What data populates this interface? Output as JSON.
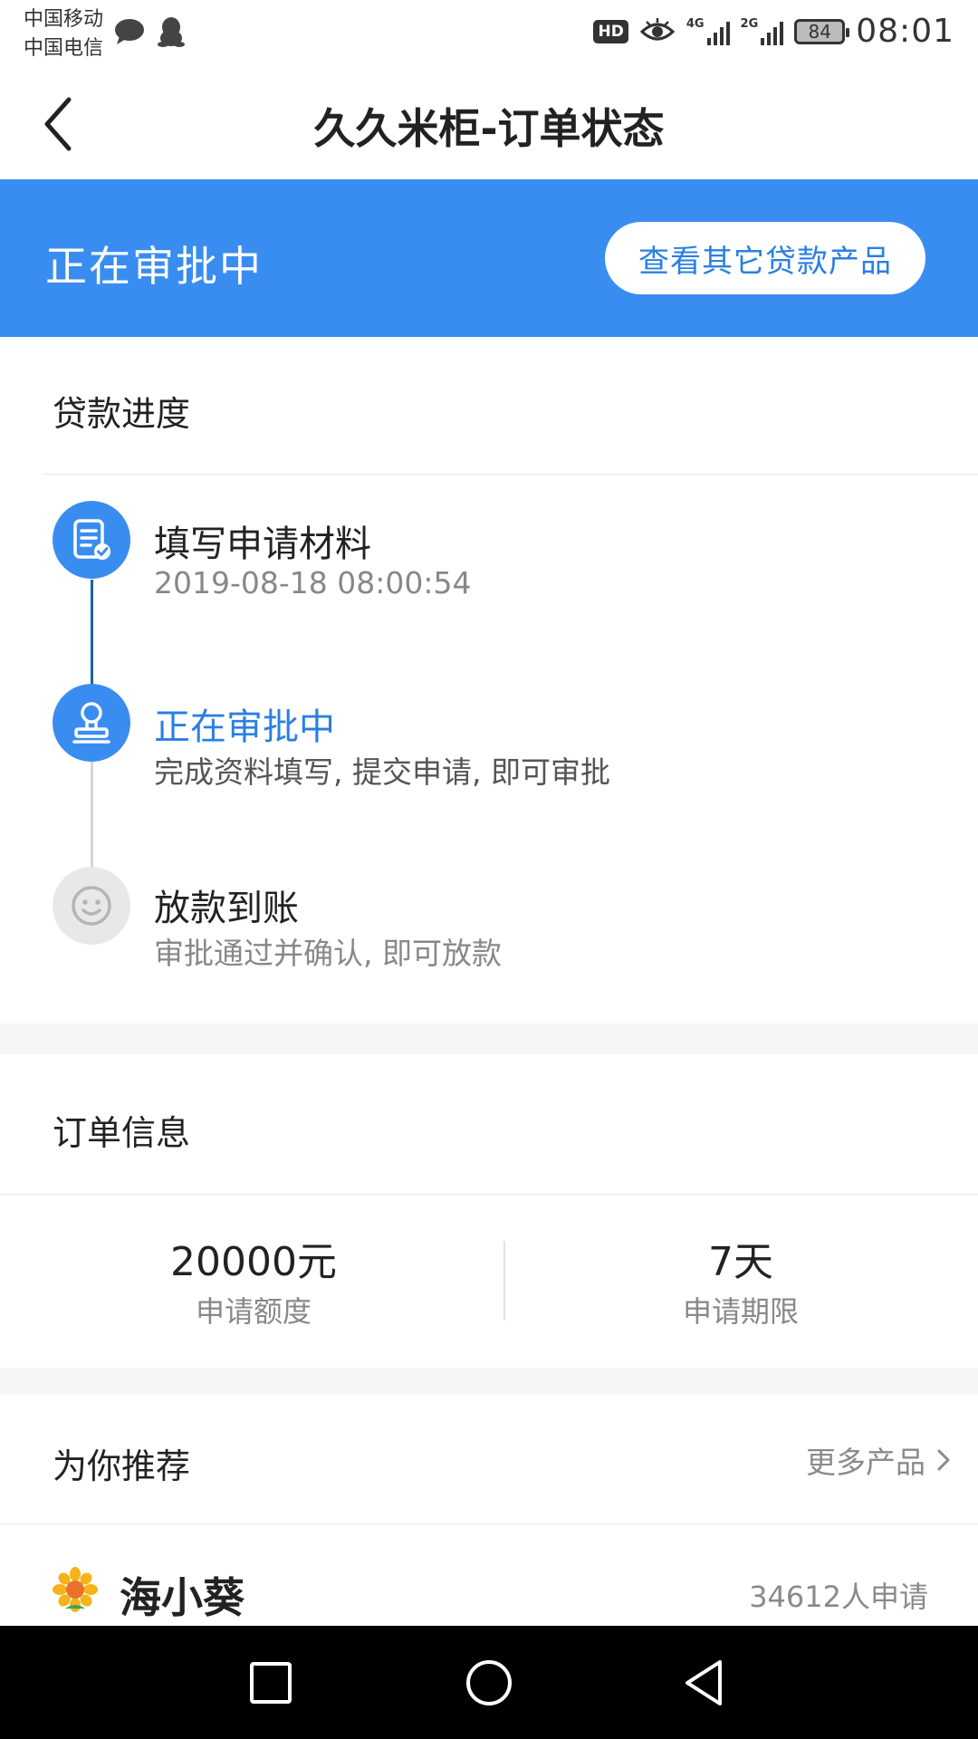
{
  "status_bar": {
    "carrier_1": "中国移动",
    "carrier_2": "中国电信",
    "hd": "HD",
    "net_1": "4G",
    "net_2": "2G",
    "battery": "84",
    "time": "08:01"
  },
  "header": {
    "title": "久久米柜-订单状态"
  },
  "banner": {
    "status": "正在审批中",
    "button_label": "查看其它贷款产品",
    "bg_color": "#3a8df0"
  },
  "progress": {
    "section_title": "贷款进度",
    "steps": [
      {
        "title": "填写申请材料",
        "sub": "2019-08-18 08:00:54",
        "icon": "document-check-icon",
        "state": "done"
      },
      {
        "title": "正在审批中",
        "sub": "完成资料填写, 提交申请, 即可审批",
        "icon": "stamp-icon",
        "state": "current"
      },
      {
        "title": "放款到账",
        "sub": "审批通过并确认, 即可放款",
        "icon": "smiley-icon",
        "state": "pending"
      }
    ]
  },
  "order_info": {
    "section_title": "订单信息",
    "amount_value": "20000元",
    "amount_label": "申请额度",
    "term_value": "7天",
    "term_label": "申请期限"
  },
  "recommend": {
    "section_title": "为你推荐",
    "more_label": "更多产品",
    "products": [
      {
        "name": "海小葵",
        "applicants": "34612人申请",
        "icon": "sunflower-icon"
      }
    ]
  },
  "nav_bar": {
    "buttons": [
      "recent-apps-icon",
      "home-icon",
      "back-triangle-icon"
    ]
  }
}
